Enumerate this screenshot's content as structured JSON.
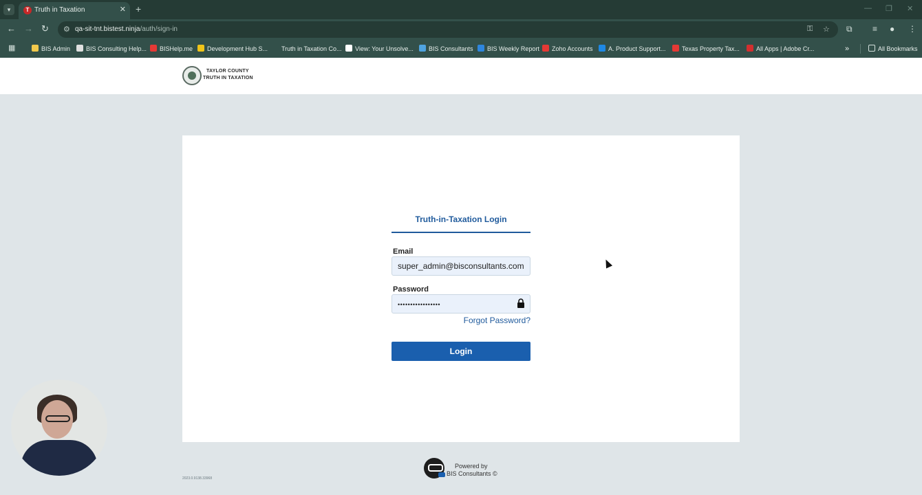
{
  "browser": {
    "tab_title": "Truth in Taxation",
    "url_host": "qa-sit-tnt.bistest.ninja",
    "url_path": "/auth/sign-in",
    "bookmarks": [
      {
        "label": "BIS Admin",
        "color": "#f2c94c"
      },
      {
        "label": "BIS Consulting Help...",
        "color": "#e0e0e0"
      },
      {
        "label": "BISHelp.me",
        "color": "#e53935"
      },
      {
        "label": "Development Hub S...",
        "color": "#f0c419"
      },
      {
        "label": "Truth in Taxation Co...",
        "color": "#33504a"
      },
      {
        "label": "View: Your Unsolve...",
        "color": "#ffffff"
      },
      {
        "label": "BIS Consultants",
        "color": "#4fa3e0"
      },
      {
        "label": "BIS Weekly Report",
        "color": "#2e86de"
      },
      {
        "label": "Zoho Accounts",
        "color": "#e53935"
      },
      {
        "label": "A. Product Support...",
        "color": "#1e88e5"
      },
      {
        "label": "Texas Property Tax...",
        "color": "#e53935"
      },
      {
        "label": "All Apps | Adobe Cr...",
        "color": "#d32f2f"
      }
    ],
    "all_bookmarks": "All Bookmarks"
  },
  "header": {
    "logo_line1": "TAYLOR COUNTY",
    "logo_line2": "TRUTH IN TAXATION"
  },
  "login": {
    "title": "Truth-in-Taxation Login",
    "email_label": "Email",
    "email_value": "super_admin@bisconsultants.com",
    "password_label": "Password",
    "password_value": "•••••••••••••••••",
    "forgot_label": "Forgot Password?",
    "login_label": "Login"
  },
  "footer": {
    "powered_line1": "Powered by",
    "powered_line2": "BIS Consultants ©",
    "version": "2023.0.9138.33968"
  },
  "colors": {
    "accent": "#1a5fae",
    "chrome": "#33504a",
    "page_bg": "#dfe5e8"
  }
}
